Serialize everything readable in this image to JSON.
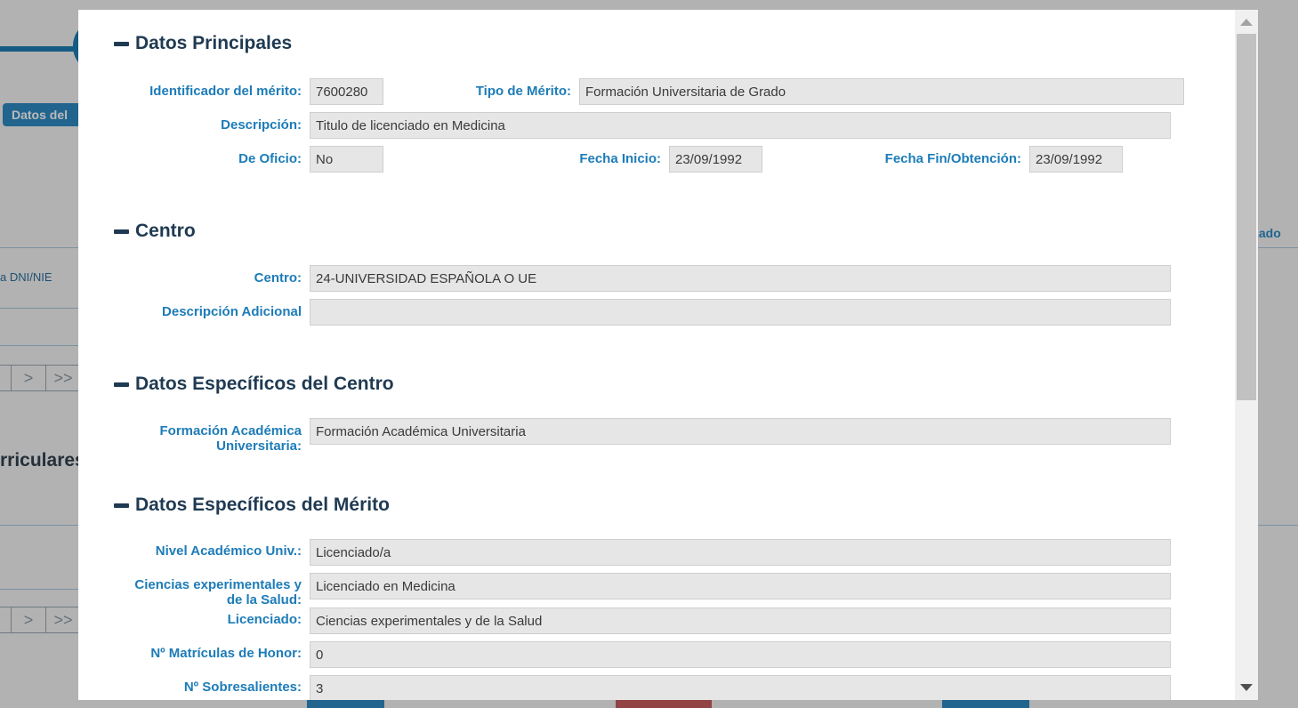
{
  "background": {
    "tab_label": "Datos del",
    "dni_label": "a DNI/NIE",
    "curriculares_label": "rriculares",
    "realizado_label": "izado",
    "pager_next": ">",
    "pager_last": ">>"
  },
  "sections": {
    "principales": "Datos Principales",
    "centro": "Centro",
    "especificos_centro": "Datos Específicos del Centro",
    "especificos_merito": "Datos Específicos del Mérito"
  },
  "principales": {
    "identificador_label": "Identificador del mérito:",
    "identificador_value": "7600280",
    "tipo_label": "Tipo de Mérito:",
    "tipo_value": "Formación Universitaria de Grado",
    "descripcion_label": "Descripción:",
    "descripcion_value": "Titulo de licenciado en Medicina",
    "oficio_label": "De Oficio:",
    "oficio_value": "No",
    "fecha_inicio_label": "Fecha Inicio:",
    "fecha_inicio_value": "23/09/1992",
    "fecha_fin_label": "Fecha Fin/Obtención:",
    "fecha_fin_value": "23/09/1992"
  },
  "centro": {
    "centro_label": "Centro:",
    "centro_value": "24-UNIVERSIDAD ESPAÑOLA O UE",
    "desc_adicional_label": "Descripción Adicional",
    "desc_adicional_value": ""
  },
  "especificos_centro": {
    "formacion_label_1": "Formación Académica",
    "formacion_label_2": "Universitaria:",
    "formacion_value": "Formación Académica Universitaria"
  },
  "especificos_merito": {
    "nivel_label": "Nivel Académico Univ.:",
    "nivel_value": "Licenciado/a",
    "ciencias_label_1": "Ciencias experimentales y",
    "ciencias_label_2": "de la Salud:",
    "ciencias_value": "Licenciado en Medicina",
    "licenciado_label": "Licenciado:",
    "licenciado_value": "Ciencias experimentales y de la Salud",
    "matriculas_label": "Nº Matrículas de Honor:",
    "matriculas_value": "0",
    "sobresalientes_label": "Nº Sobresalientes:",
    "sobresalientes_value": "3"
  }
}
